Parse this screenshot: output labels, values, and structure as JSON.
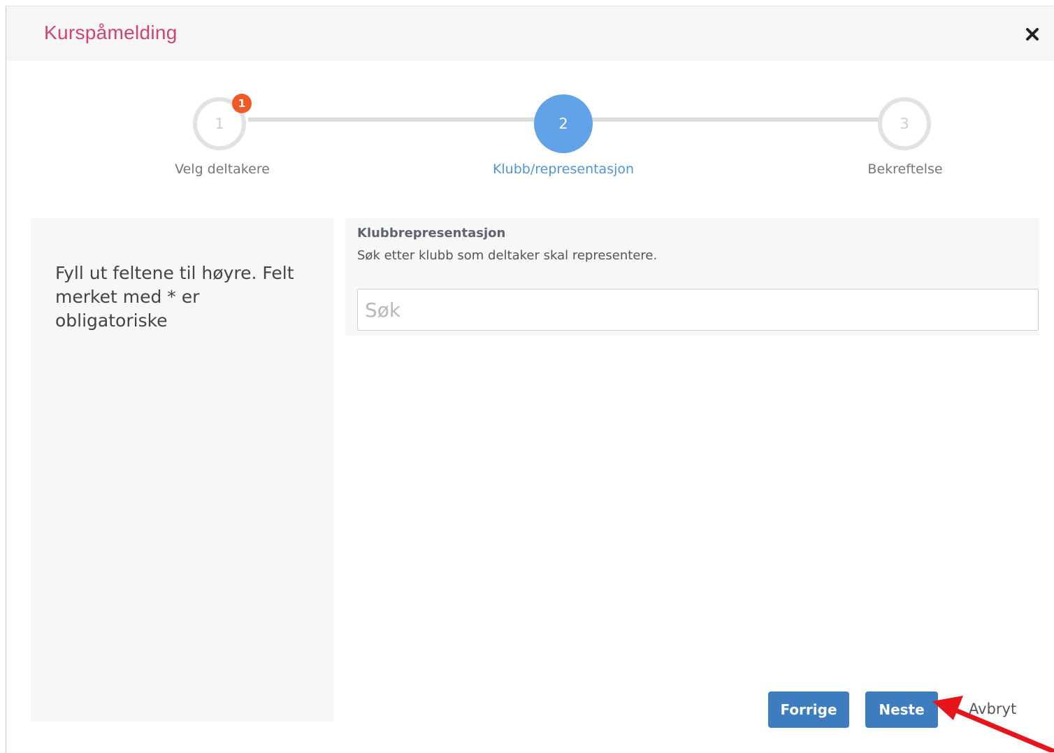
{
  "modal": {
    "title": "Kurspåmelding",
    "close_icon": "close-icon"
  },
  "stepper": {
    "steps": [
      {
        "number": "1",
        "label": "Velg deltakere",
        "state": "inactive",
        "badge": "1"
      },
      {
        "number": "2",
        "label": "Klubb/representasjon",
        "state": "active"
      },
      {
        "number": "3",
        "label": "Bekreftelse",
        "state": "inactive"
      }
    ]
  },
  "left_panel": {
    "instructions": "Fyll ut feltene til høyre. Felt merket med * er obligatoriske"
  },
  "form": {
    "title": "Klubbrepresentasjon",
    "description": "Søk etter klubb som deltaker skal representere.",
    "search": {
      "placeholder": "Søk",
      "value": ""
    }
  },
  "footer": {
    "prev_label": "Forrige",
    "next_label": "Neste",
    "cancel_label": "Avbryt"
  },
  "colors": {
    "title": "#d4426e",
    "active_step": "#62a2e8",
    "badge": "#f15a24",
    "button": "#3d7dbf",
    "annotation_arrow": "#e8141b"
  }
}
